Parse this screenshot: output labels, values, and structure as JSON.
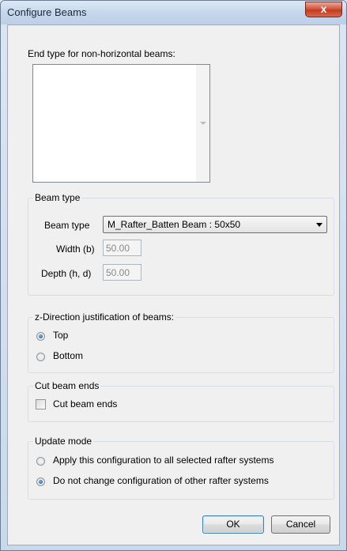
{
  "window": {
    "title": "Configure Beams",
    "close_glyph": "x"
  },
  "end_type": {
    "label": "End type for non-horizontal beams:",
    "items": []
  },
  "beam_type_group": {
    "title": "Beam type",
    "type_label": "Beam type",
    "type_value": "M_Rafter_Batten Beam : 50x50",
    "width_label": "Width (b)",
    "width_value": "50.00",
    "depth_label": "Depth (h, d)",
    "depth_value": "50.00"
  },
  "z_direction": {
    "title": "z-Direction justification of beams:",
    "options": [
      {
        "label": "Top",
        "selected": true
      },
      {
        "label": "Bottom",
        "selected": false
      }
    ]
  },
  "cut_ends": {
    "title": "Cut beam ends",
    "checkbox_label": "Cut beam ends",
    "checked": false
  },
  "update_mode": {
    "title": "Update mode",
    "options": [
      {
        "label": "Apply this configuration to all selected rafter systems",
        "selected": false
      },
      {
        "label": "Do not change configuration of other rafter systems",
        "selected": true
      }
    ]
  },
  "buttons": {
    "ok": "OK",
    "cancel": "Cancel"
  }
}
